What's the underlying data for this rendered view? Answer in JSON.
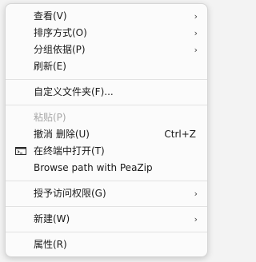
{
  "menu": {
    "items": [
      {
        "label": "查看(V)"
      },
      {
        "label": "排序方式(O)"
      },
      {
        "label": "分组依据(P)"
      },
      {
        "label": "刷新(E)"
      },
      {
        "label": "自定义文件夹(F)..."
      },
      {
        "label": "粘贴(P)"
      },
      {
        "label": "撤消 删除(U)",
        "shortcut": "Ctrl+Z"
      },
      {
        "label": "在终端中打开(T)",
        "icon": "terminal-icon"
      },
      {
        "label": "Browse path with PeaZip"
      },
      {
        "label": "授予访问权限(G)"
      },
      {
        "label": "新建(W)"
      },
      {
        "label": "属性(R)"
      }
    ],
    "submenu_arrow": "›"
  }
}
